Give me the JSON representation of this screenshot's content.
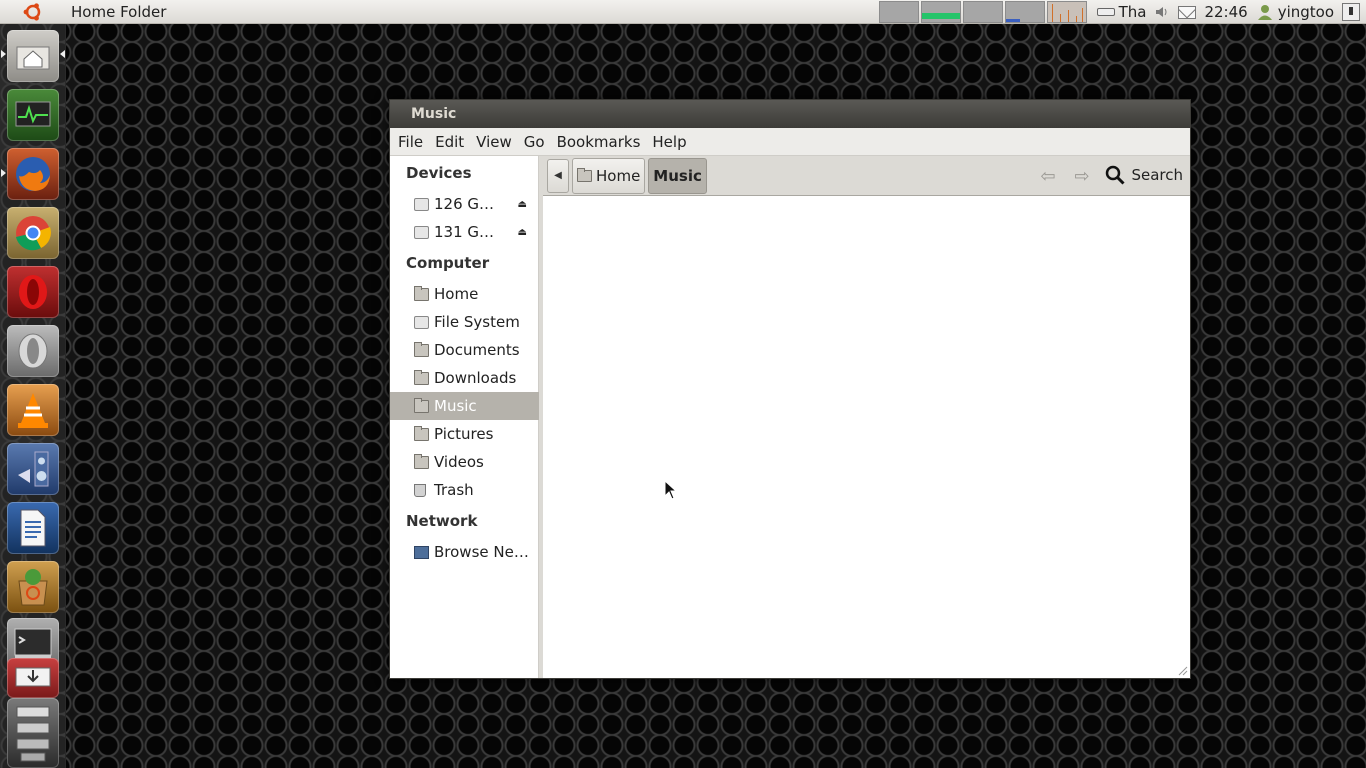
{
  "panel": {
    "app_title": "Home Folder",
    "keyboard_layout": "Tha",
    "clock": "22:46",
    "username": "yingtoo"
  },
  "launcher": {
    "items": [
      "home-folder",
      "system-monitor",
      "firefox",
      "chrome",
      "opera",
      "opera-next",
      "vlc",
      "sound-settings",
      "writer",
      "software-center",
      "terminal",
      "trash-stack"
    ]
  },
  "window": {
    "title": "Music",
    "menu": [
      "File",
      "Edit",
      "View",
      "Go",
      "Bookmarks",
      "Help"
    ],
    "sidebar": {
      "devices_heading": "Devices",
      "devices": [
        "126 G…",
        "131 G…"
      ],
      "computer_heading": "Computer",
      "places": [
        "Home",
        "File System",
        "Documents",
        "Downloads",
        "Music",
        "Pictures",
        "Videos",
        "Trash"
      ],
      "network_heading": "Network",
      "network": [
        "Browse Ne…"
      ],
      "selected": "Music"
    },
    "pathbar": {
      "crumbs": [
        "Home",
        "Music"
      ],
      "search_label": "Search"
    }
  },
  "colors": {
    "title_bar": "#3c3b37",
    "selected_row": "#b5b2ab",
    "panel_bg": "#dcdad5"
  }
}
